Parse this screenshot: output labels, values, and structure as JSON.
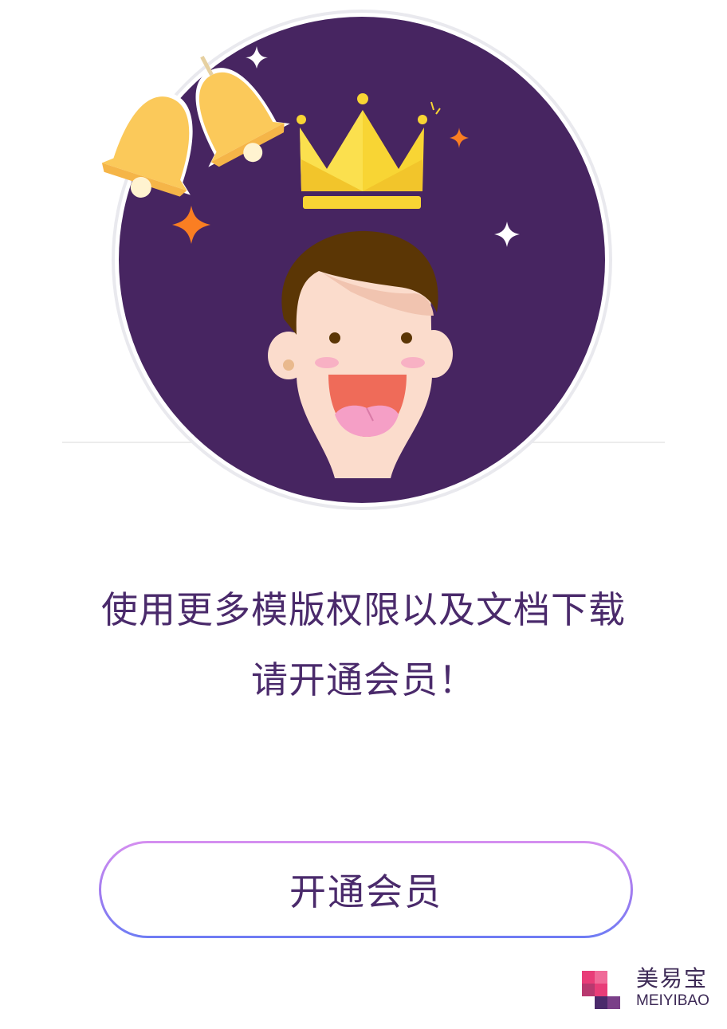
{
  "illustration": {
    "icons": [
      "bells-icon",
      "crown-icon",
      "sparkle-icon",
      "laughing-face-icon"
    ],
    "colors": {
      "circle": "#472561",
      "crown": "#f8d534",
      "bell": "#fbc95a",
      "hair": "#5b3605",
      "skin": "#fbdccc",
      "mouth": "#ef6b59",
      "tongue": "#f59fc6",
      "spark_orange": "#fa7e22"
    }
  },
  "message": {
    "line1": "使用更多模版权限以及文档下载",
    "line2": "请开通会员！",
    "color": "#4a2a6b"
  },
  "cta": {
    "label": "开通会员",
    "gradient": [
      "#d58ff0",
      "#6e7cf4"
    ]
  },
  "brand": {
    "name_cn": "美易宝",
    "name_en": "MEIYIBAO",
    "logo_colors": [
      "#e83d78",
      "#b8396f",
      "#4a2a6b"
    ]
  }
}
